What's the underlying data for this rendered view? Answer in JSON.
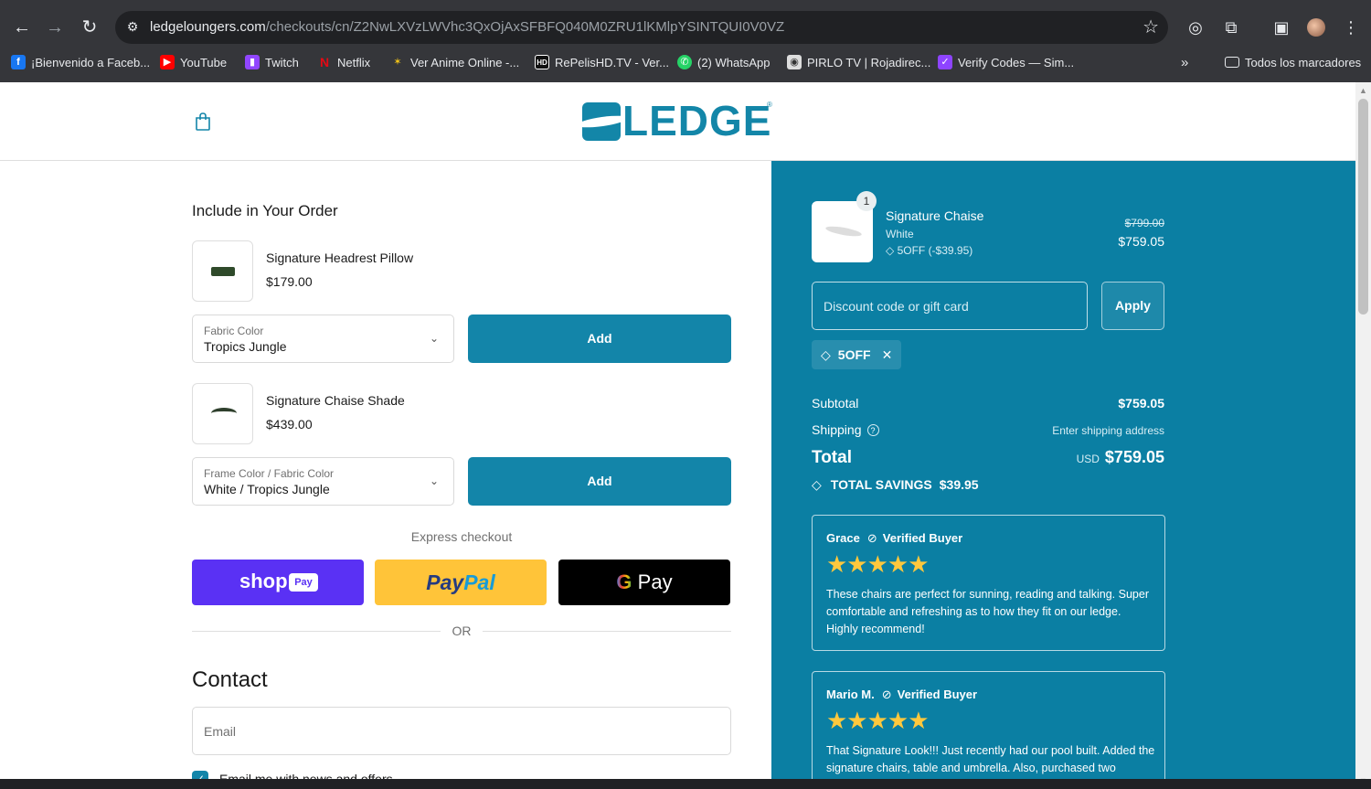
{
  "browser": {
    "url_host": "ledgeloungers.com",
    "url_path": "/checkouts/cn/Z2NwLXVzLWVhc3QxOjAxSFBFQ040M0ZRU1lKMlpYSINTQUI0V0VZ",
    "bookmarks": [
      {
        "label": "¡Bienvenido a Faceb...",
        "icon": "facebook-icon",
        "color": "#1877f2"
      },
      {
        "label": "YouTube",
        "icon": "youtube-icon",
        "color": "#ff0000"
      },
      {
        "label": "Twitch",
        "icon": "twitch-icon",
        "color": "#9146ff"
      },
      {
        "label": "Netflix",
        "icon": "netflix-icon",
        "color": "#e50914"
      },
      {
        "label": "Ver Anime Online -...",
        "icon": "anime-icon",
        "color": "#f5c518"
      },
      {
        "label": "RePelisHD.TV - Ver...",
        "icon": "hd-icon",
        "color": "#111111"
      },
      {
        "label": "(2) WhatsApp",
        "icon": "whatsapp-icon",
        "color": "#25d366"
      },
      {
        "label": "PIRLO TV | Rojadirec...",
        "icon": "pirlo-icon",
        "color": "#dddddd"
      },
      {
        "label": "Verify Codes — Sim...",
        "icon": "verify-icon",
        "color": "#8e44ff"
      }
    ],
    "all_bookmarks": "Todos los marcadores"
  },
  "header": {
    "logo_text": "LEDGE"
  },
  "upsell": {
    "title": "Include in Your Order",
    "items": [
      {
        "name": "Signature Headrest Pillow",
        "price": "$179.00",
        "option_label": "Fabric Color",
        "option_value": "Tropics Jungle",
        "button": "Add"
      },
      {
        "name": "Signature Chaise Shade",
        "price": "$439.00",
        "option_label": "Frame Color / Fabric Color",
        "option_value": "White / Tropics Jungle",
        "button": "Add"
      }
    ]
  },
  "express": {
    "title": "Express checkout",
    "shoppay": "shop",
    "shoppay_pill": "Pay",
    "paypal_a": "Pay",
    "paypal_b": "Pal",
    "gpay_g": "G",
    "gpay_text": "Pay",
    "or": "OR"
  },
  "contact": {
    "title": "Contact",
    "email_placeholder": "Email",
    "newsletter": "Email me with news and offers"
  },
  "summary": {
    "item": {
      "qty": "1",
      "name": "Signature Chaise",
      "variant": "White",
      "discount": "5OFF (-$39.95)",
      "old_price": "$799.00",
      "price": "$759.05"
    },
    "discount_placeholder": "Discount code or gift card",
    "apply": "Apply",
    "applied_code": "5OFF",
    "subtotal_label": "Subtotal",
    "subtotal": "$759.05",
    "shipping_label": "Shipping",
    "shipping_value": "Enter shipping address",
    "total_label": "Total",
    "currency": "USD",
    "total": "$759.05",
    "savings_label": "TOTAL SAVINGS",
    "savings": "$39.95"
  },
  "reviews": [
    {
      "name": "Grace",
      "badge": "Verified Buyer",
      "stars": "★★★★★",
      "text": "These chairs are perfect for sunning, reading and talking. Super comfortable and refreshing as to how they fit on our ledge. Highly recommend!"
    },
    {
      "name": "Mario M.",
      "badge": "Verified Buyer",
      "stars": "★★★★★",
      "text": "That Signature Look!!! Just recently had our pool built. Added the signature chairs, table and umbrella. Also, purchased two"
    }
  ],
  "colors": {
    "brand": "#1385a9",
    "summary_bg": "#0b7fa3",
    "shoppay": "#5a31f4",
    "paypal": "#ffc439"
  }
}
